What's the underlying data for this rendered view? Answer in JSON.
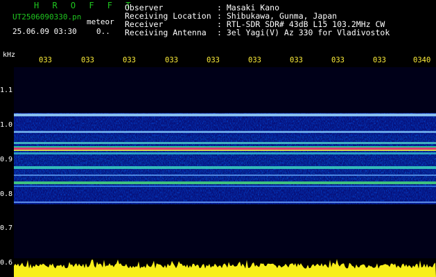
{
  "header": {
    "title": "H R O F F T",
    "filename": "UT2506090330.pn",
    "meteor_label": "meteor",
    "datetime": "25.06.09 03:30",
    "count": "0.."
  },
  "info": {
    "labels": [
      "Observer",
      "Receiving Location",
      "Receiver",
      "Receiving Antenna"
    ],
    "values": [
      ": Masaki Kano",
      ": Shibukawa, Gunma, Japan",
      ": RTL-SDR SDR# 43dB L15 103.2MHz CW",
      ": 3el Yagi(V) Az 330 for Vladivostok"
    ]
  },
  "y_axis": {
    "unit": "kHz",
    "ticks": [
      "1.1",
      "1.0",
      "0.9",
      "0.8",
      "0.7",
      "0.6"
    ]
  },
  "x_axis": {
    "ticks": [
      "033",
      "033",
      "033",
      "033",
      "033",
      "033",
      "033",
      "033",
      "033",
      "0340"
    ]
  },
  "colors": {
    "background": "#000000",
    "header_green": "#1fc61f",
    "tick_yellow": "#ffef3a",
    "text_white": "#ffffff",
    "spectrum_blue": "#0a1a9c"
  }
}
